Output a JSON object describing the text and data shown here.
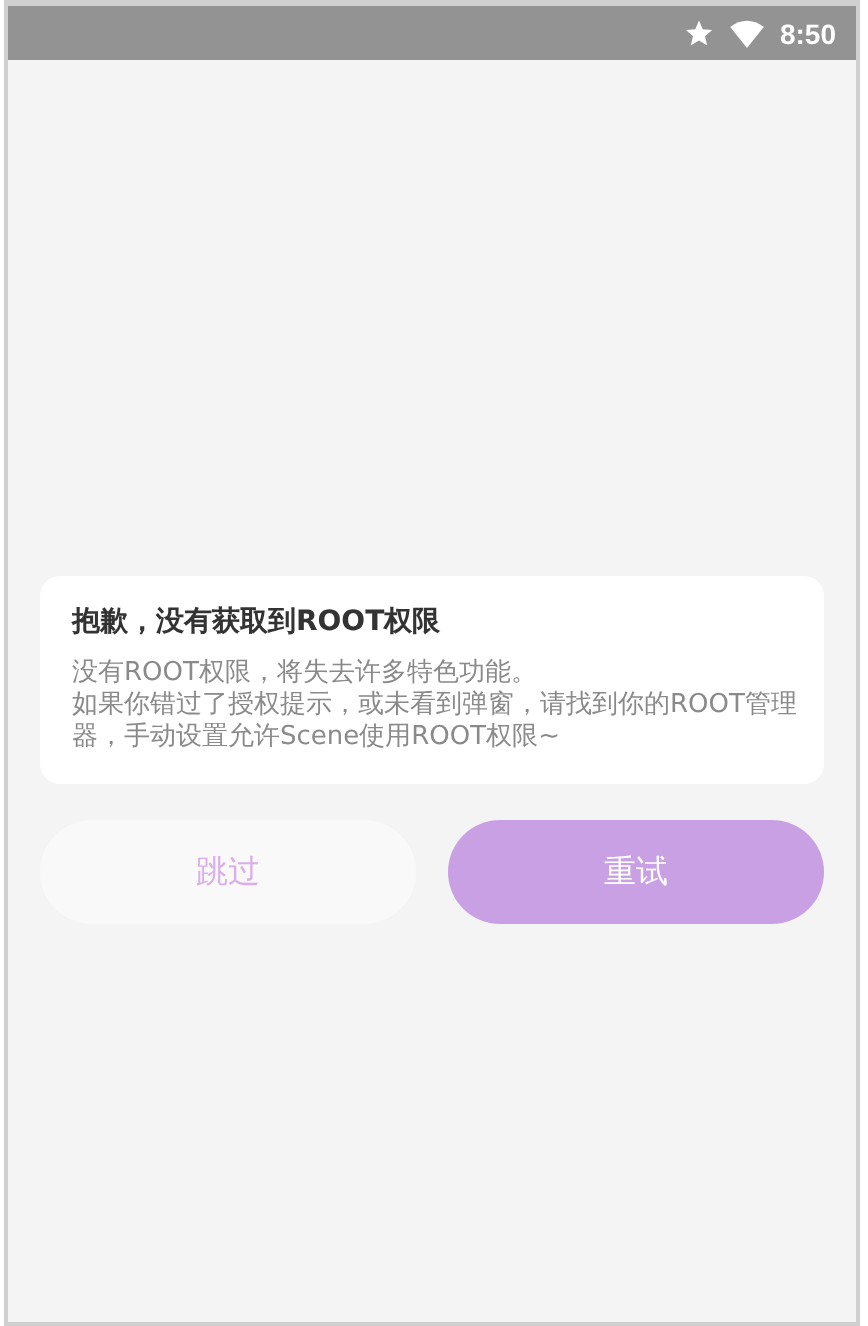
{
  "status_bar": {
    "time": "8:50"
  },
  "dialog": {
    "title": "抱歉，没有获取到ROOT权限",
    "paragraphs": [
      "没有ROOT权限，将失去许多特色功能。",
      "如果你错过了授权提示，或未看到弹窗，请找到你的ROOT管理器，手动设置允许Scene使用ROOT权限~"
    ]
  },
  "buttons": [
    {
      "label": "跳过",
      "kind": "secondary"
    },
    {
      "label": "重试",
      "kind": "primary"
    }
  ]
}
